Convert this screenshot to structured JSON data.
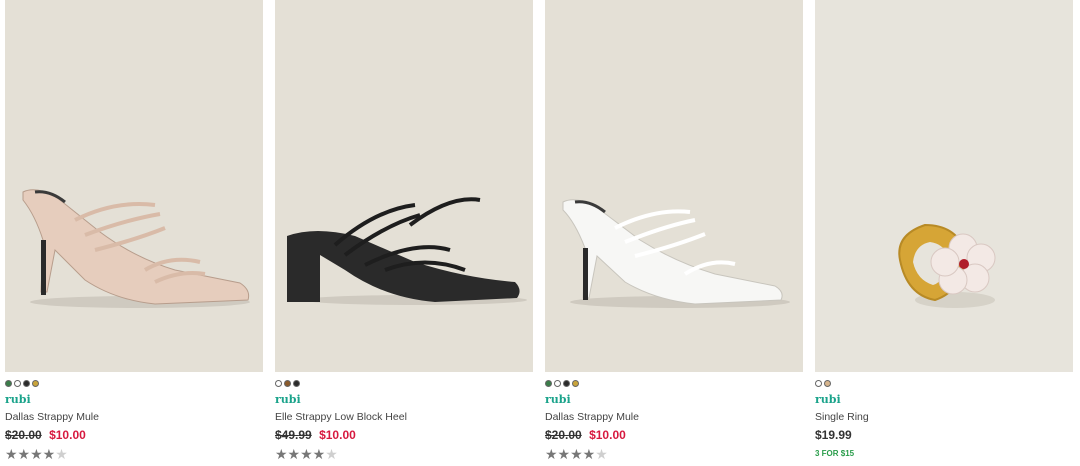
{
  "colors": {
    "sale": "#d7193f",
    "brand": "#1aa38b",
    "promo": "#2a9d4b",
    "image_bg": "#e4e0d6"
  },
  "products": [
    {
      "name": "Dallas Strappy Mule",
      "brand": "rubi",
      "was_dollars": "$20",
      "was_cents": "00",
      "now_dollars": "$10",
      "now_cents": "00",
      "rating": 4,
      "swatches": [
        "#3b7d4a",
        "#ffffff",
        "#2b2b2b",
        "#c9a43a"
      ],
      "image_icon": "strappy-heel-nude"
    },
    {
      "name": "Elle Strappy Low Block Heel",
      "brand": "rubi",
      "was_dollars": "$49",
      "was_cents": "99",
      "now_dollars": "$10",
      "now_cents": "00",
      "rating": 4,
      "swatches": [
        "#ffffff",
        "#8a5a2b",
        "#2b2b2b"
      ],
      "image_icon": "block-heel-black"
    },
    {
      "name": "Dallas Strappy Mule",
      "brand": "rubi",
      "was_dollars": "$20",
      "was_cents": "00",
      "now_dollars": "$10",
      "now_cents": "00",
      "rating": 4,
      "swatches": [
        "#3b7d4a",
        "#ffffff",
        "#2b2b2b",
        "#c9a43a"
      ],
      "image_icon": "strappy-heel-white"
    },
    {
      "name": "Single Ring",
      "brand": "rubi",
      "price_dollars": "$19",
      "price_cents": "99",
      "promo": "3 FOR $15",
      "swatches": [
        "#ffffff",
        "#d6b48c"
      ],
      "image_icon": "flower-ring"
    }
  ]
}
